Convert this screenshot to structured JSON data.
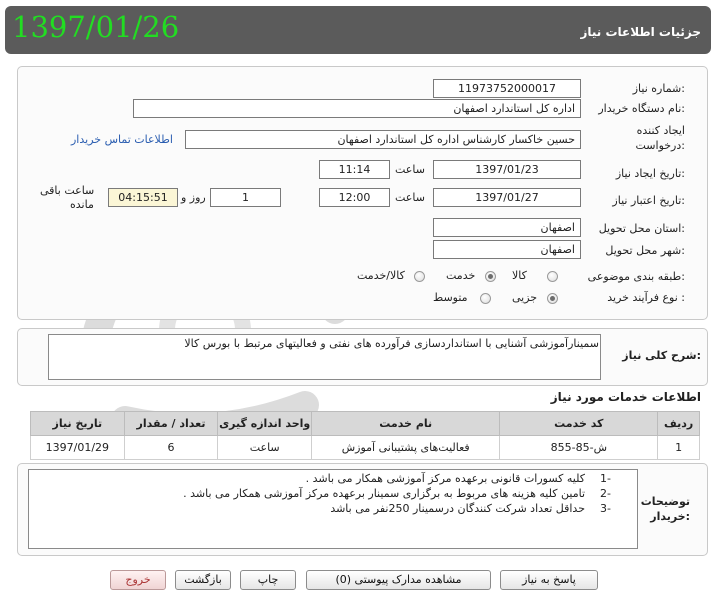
{
  "stamp": "1397/01/26",
  "header": {
    "title": "جزئیات اطلاعات نیاز"
  },
  "form": {
    "need_number_label": "شماره نیاز:",
    "need_number": "1197375200001​7",
    "buyer_label": "نام دستگاه خریدار:",
    "buyer": "اداره کل استاندارد اصفهان",
    "creator_label_1": "ایجاد کننده",
    "creator_label_2": "درخواست:",
    "creator": "حسین  خاکسار کارشناس اداره کل استاندارد اصفهان",
    "contact_link": "اطلاعات تماس خریدار",
    "created_date_label": "تاریخ ایجاد نیاز:",
    "created_date": "1397/01/23",
    "time_label": "ساعت",
    "created_time": "11:14",
    "validity_label": "تاریخ اعتبار نیاز:",
    "validity_date": "1397/01/27",
    "validity_time": "12:00",
    "days_value": "1",
    "days_label": "روز و",
    "remaining_time": "04:15:51",
    "remaining_label_1": "ساعت باقی",
    "remaining_label_2": "مانده",
    "province_label": "استان محل تحویل:",
    "province": "اصفهان",
    "city_label": "شهر محل تحویل:",
    "city": "اصفهان",
    "category_label": "طبقه بندی موضوعی:",
    "category_options": [
      "کالا",
      "خدمت",
      "کالا/خدمت"
    ],
    "category_selected": "خدمت",
    "process_label": "نوع فرآیند خرید :",
    "process_options": [
      "جزیی",
      "متوسط"
    ],
    "process_selected": "جزیی"
  },
  "description": {
    "label": "شرح کلی نیاز:",
    "text": "سمینارآموزشی آشنایی با استانداردسازی فرآورده های نفتی و فعالیتهای مرتبط با بورس کالا"
  },
  "services": {
    "title": "اطلاعات خدمات مورد نیاز",
    "columns": [
      "ردیف",
      "کد خدمت",
      "نام خدمت",
      "واحد اندازه گیری",
      "تعداد / مقدار",
      "تاریخ نیاز"
    ],
    "rows": [
      {
        "row": "1",
        "code": "ش-85-855",
        "name": "فعالیت‌های پشتیبانی آموزش",
        "unit": "ساعت",
        "qty": "6",
        "date": "1397/01/29"
      }
    ]
  },
  "notes": {
    "label_1": "توضیحات",
    "label_2": "خریدار:",
    "items": [
      {
        "num": "1-",
        "text": "کلیه کسورات قانونی برعهده مرکز آموزشی همکار می باشد ."
      },
      {
        "num": "2-",
        "text": "تامین کلیه هزینه های مربوط به برگزاری سمینار  برعهده مرکز آموزشی همکار می باشد ."
      },
      {
        "num": "3-",
        "text": "حداقل تعداد شرکت کنندگان درسمینار 250نفر می باشد"
      }
    ]
  },
  "buttons": {
    "reply": "پاسخ به نیاز",
    "view_docs": "مشاهده مدارک پیوستی (0)",
    "print": "چاپ",
    "back": "بازگشت",
    "exit": "خروج"
  },
  "colors": {
    "header_bg": "#5b5b5b",
    "stamp": "#22dd22",
    "link": "#2a5db0"
  }
}
